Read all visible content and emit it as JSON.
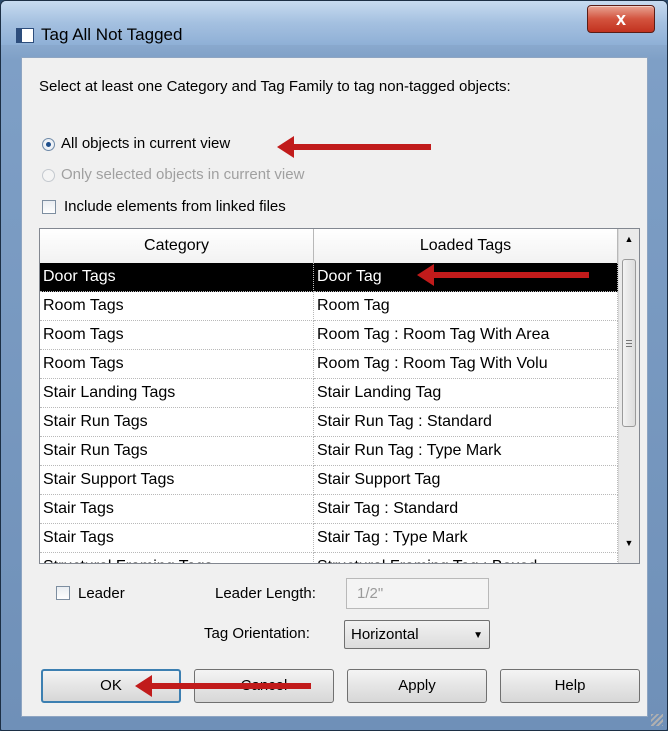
{
  "window": {
    "title": "Tag All Not Tagged",
    "close_label": "x"
  },
  "instruction": "Select at least one Category and Tag Family to tag non-tagged objects:",
  "scope": {
    "all_objects_label": "All objects in current view",
    "selected_objects_label": "Only selected objects in current view",
    "selected": "all_objects"
  },
  "include_linked_label": "Include elements from linked files",
  "grid": {
    "columns": [
      "Category",
      "Loaded Tags"
    ],
    "rows": [
      {
        "category": "Door Tags",
        "tag": "Door Tag"
      },
      {
        "category": "Room Tags",
        "tag": "Room Tag"
      },
      {
        "category": "Room Tags",
        "tag": "Room Tag : Room Tag With Area"
      },
      {
        "category": "Room Tags",
        "tag": "Room Tag : Room Tag With Volu"
      },
      {
        "category": "Stair Landing Tags",
        "tag": "Stair Landing Tag"
      },
      {
        "category": "Stair Run Tags",
        "tag": "Stair Run Tag : Standard"
      },
      {
        "category": "Stair Run Tags",
        "tag": "Stair Run Tag : Type Mark"
      },
      {
        "category": "Stair Support Tags",
        "tag": "Stair Support Tag"
      },
      {
        "category": "Stair Tags",
        "tag": "Stair Tag : Standard"
      },
      {
        "category": "Stair Tags",
        "tag": "Stair Tag : Type Mark"
      },
      {
        "category": "Structural Framing Tags",
        "tag": "Structural Framing Tag : Boxed"
      }
    ],
    "selected_row": 0
  },
  "leader": {
    "checkbox_label": "Leader",
    "length_label": "Leader Length:",
    "length_value": "1/2\"",
    "orientation_label": "Tag Orientation:",
    "orientation_value": "Horizontal"
  },
  "buttons": {
    "ok": "OK",
    "cancel": "Cancel",
    "apply": "Apply",
    "help": "Help"
  },
  "colors": {
    "annotation_arrow": "#c11b1b",
    "selected_row_bg": "#000000",
    "close_button": "#c2321f"
  }
}
